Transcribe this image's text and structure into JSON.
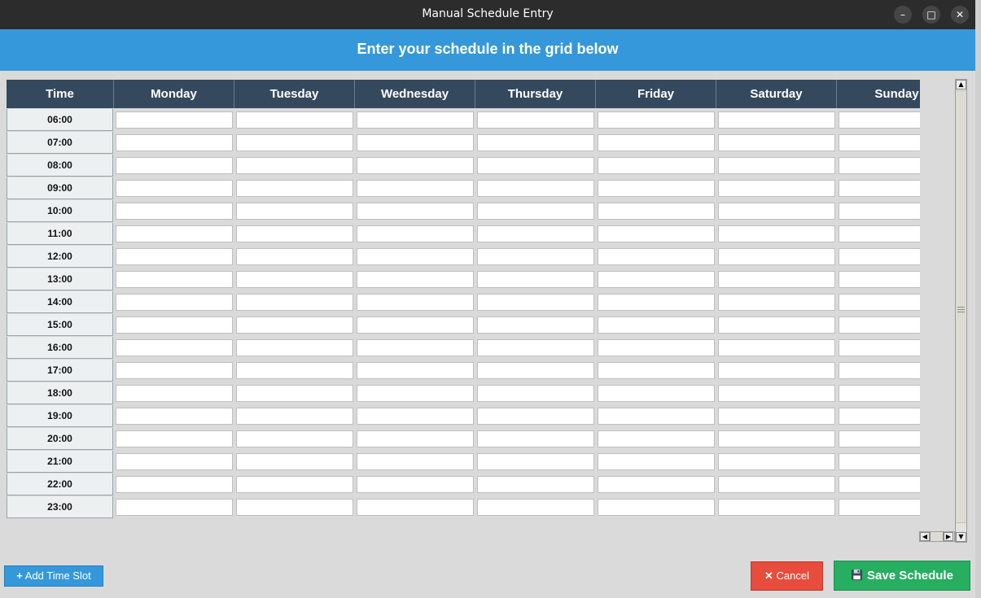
{
  "window": {
    "title": "Manual Schedule Entry",
    "minimize_glyph": "–",
    "maximize_glyph": "□",
    "close_glyph": "✕"
  },
  "banner": {
    "text": "Enter your schedule in the grid below"
  },
  "grid": {
    "time_header": "Time",
    "days": [
      "Monday",
      "Tuesday",
      "Wednesday",
      "Thursday",
      "Friday",
      "Saturday",
      "Sunday"
    ],
    "times": [
      "06:00",
      "07:00",
      "08:00",
      "09:00",
      "10:00",
      "11:00",
      "12:00",
      "13:00",
      "14:00",
      "15:00",
      "16:00",
      "17:00",
      "18:00",
      "19:00",
      "20:00",
      "21:00",
      "22:00",
      "23:00"
    ]
  },
  "buttons": {
    "add_time_slot": "Add Time Slot",
    "add_icon": "plus-icon",
    "cancel": "Cancel",
    "cancel_icon": "close-icon",
    "save": "Save Schedule",
    "save_icon": "floppy-disk-icon"
  },
  "colors": {
    "banner": "#3498db",
    "header": "#34495e",
    "time_cell": "#ecf0f1",
    "cancel": "#e74c3c",
    "save": "#27ae60",
    "add": "#3498db"
  }
}
